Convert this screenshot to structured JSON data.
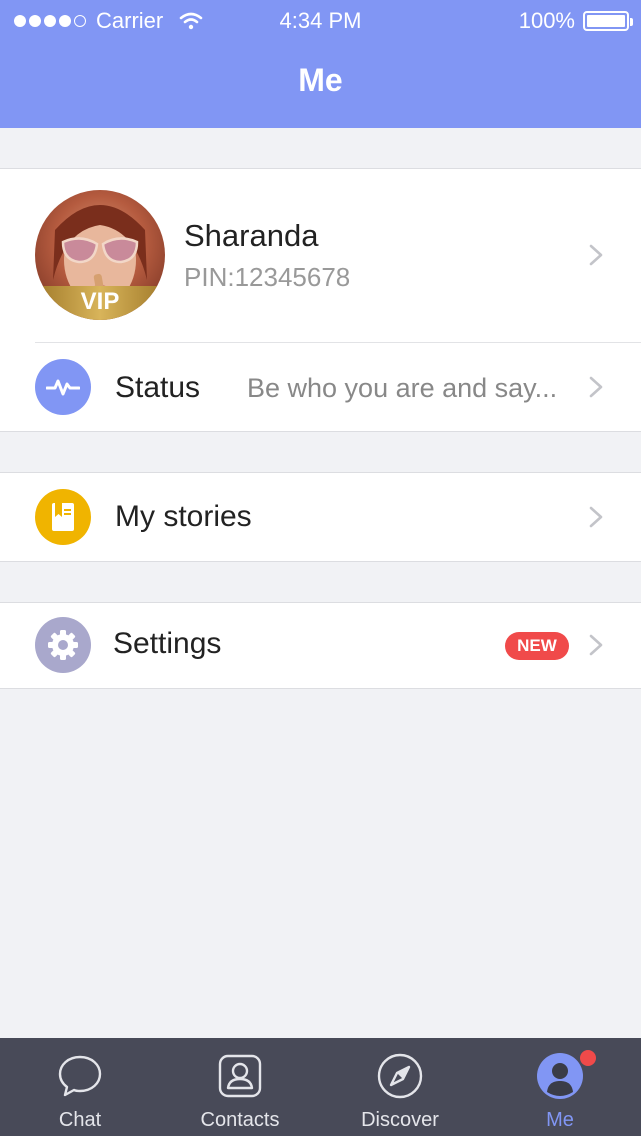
{
  "status_bar": {
    "carrier": "Carrier",
    "time": "4:34 PM",
    "battery": "100%"
  },
  "header": {
    "title": "Me"
  },
  "profile": {
    "name": "Sharanda",
    "pin": "PIN:12345678",
    "vip_label": "VIP"
  },
  "rows": {
    "status": {
      "label": "Status",
      "detail": "Be who you are and say...",
      "icon": "pulse-icon",
      "color": "#8196f4"
    },
    "stories": {
      "label": "My stories",
      "icon": "book-icon",
      "color": "#f0b400"
    },
    "settings": {
      "label": "Settings",
      "badge": "NEW",
      "icon": "gear-icon",
      "color": "#a9a8cc"
    }
  },
  "tabbar": {
    "tabs": [
      {
        "label": "Chat",
        "icon": "chat-bubble-icon"
      },
      {
        "label": "Contacts",
        "icon": "contacts-icon"
      },
      {
        "label": "Discover",
        "icon": "compass-icon"
      },
      {
        "label": "Me",
        "icon": "profile-icon",
        "active": true
      }
    ]
  },
  "colors": {
    "accent": "#8196f4",
    "badge": "#f04a4a",
    "tabbar": "#484a58"
  }
}
